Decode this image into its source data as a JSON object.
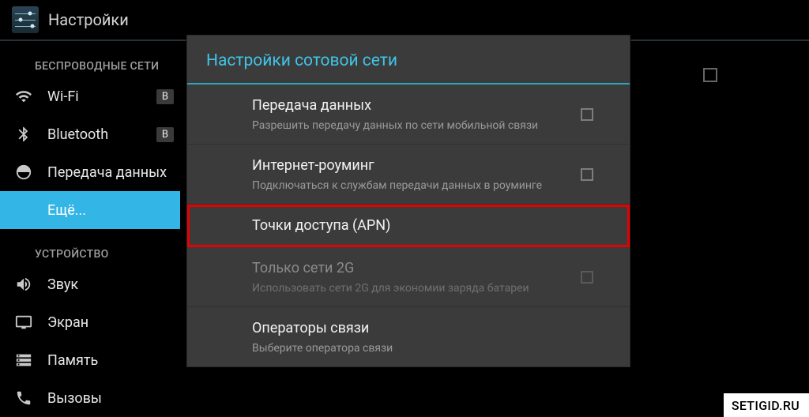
{
  "app_title": "Настройки",
  "sidebar": {
    "sections": [
      {
        "label": "БЕСПРОВОДНЫЕ СЕТИ",
        "items": [
          {
            "icon": "wifi",
            "label": "Wi-Fi",
            "pill": "В",
            "interactable": true,
            "name": "sidebar-item-wifi"
          },
          {
            "icon": "bluetooth",
            "label": "Bluetooth",
            "pill": "В",
            "interactable": true,
            "name": "sidebar-item-bluetooth"
          },
          {
            "icon": "data",
            "label": "Передача данных",
            "interactable": true,
            "name": "sidebar-item-data"
          },
          {
            "icon": "",
            "label": "Ещё...",
            "more": true,
            "interactable": true,
            "name": "sidebar-item-more"
          }
        ]
      },
      {
        "label": "УСТРОЙСТВО",
        "items": [
          {
            "icon": "sound",
            "label": "Звук",
            "interactable": true,
            "name": "sidebar-item-sound"
          },
          {
            "icon": "display",
            "label": "Экран",
            "interactable": true,
            "name": "sidebar-item-display"
          },
          {
            "icon": "storage",
            "label": "Память",
            "interactable": true,
            "name": "sidebar-item-storage"
          },
          {
            "icon": "calls",
            "label": "Вызовы",
            "interactable": true,
            "name": "sidebar-item-calls"
          }
        ]
      }
    ]
  },
  "dialog": {
    "title": "Настройки сотовой сети",
    "items": [
      {
        "name": "row-data-enabled",
        "title": "Передача данных",
        "sub": "Разрешить передачу данных по сети мобильной связи",
        "checkbox": true,
        "disabled": false,
        "highlight": false
      },
      {
        "name": "row-data-roaming",
        "title": "Интернет-роуминг",
        "sub": "Подключаться к службам передачи данных в роуминге",
        "checkbox": true,
        "disabled": false,
        "highlight": false
      },
      {
        "name": "row-apn",
        "title": "Точки доступа (APN)",
        "sub": "",
        "checkbox": false,
        "disabled": false,
        "highlight": true
      },
      {
        "name": "row-2g-only",
        "title": "Только сети 2G",
        "sub": "Использовать сети 2G для экономии заряда батареи",
        "checkbox": true,
        "disabled": true,
        "highlight": false
      },
      {
        "name": "row-operators",
        "title": "Операторы связи",
        "sub": "Выберите оператора связи",
        "checkbox": false,
        "disabled": false,
        "highlight": false
      }
    ]
  },
  "watermark": "SETIGID.RU"
}
